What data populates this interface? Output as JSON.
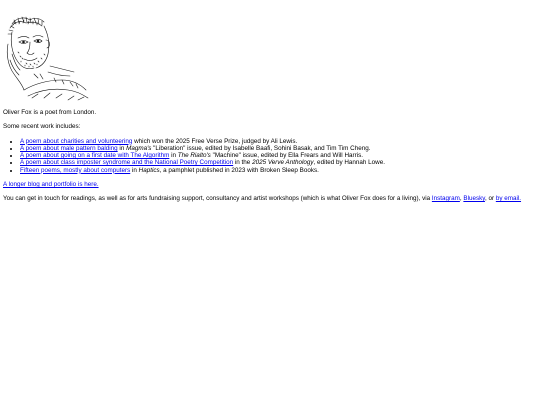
{
  "portrait": {
    "icon": "self-portrait-sketch-icon"
  },
  "intro": "Oliver Fox is a poet from London.",
  "recent_heading": "Some recent work includes:",
  "works": [
    {
      "link": "A poem about charities and volunteering",
      "pre_italic": " which won the 2025 Free Verse Prize, judged by Ali Lewis.",
      "italic": "",
      "post": ""
    },
    {
      "link": "A poem about male pattern balding",
      "pre_italic": " in ",
      "italic": "Magma's",
      "post": " \"Liberation\" issue, edited by Isabelle Baafi, Sohini Basak, and Tim Tim Cheng."
    },
    {
      "link": "A poem about going on a first date with The Algorithm",
      "pre_italic": " in ",
      "italic": "The Rialto's",
      "post": " \"Machine\" issue, edited by Ella Frears and Will Harris."
    },
    {
      "link": "A poem about class imposter syndrome and the National Poetry Competition",
      "pre_italic": " in the ",
      "italic": "2025 Verve Anthology",
      "post": ", edited by Hannah Lowe."
    },
    {
      "link": "Fifteen poems, mostly about computers",
      "pre_italic": " in ",
      "italic": "Haptics",
      "post": ", a pamphlet published in 2023 with Broken Sleep Books."
    }
  ],
  "blog_link": "A longer blog and portfolio is here.",
  "contact": {
    "text": "You can get in touch for readings, as well as for arts fundraising support, consultancy and artist workshops (which is what Oliver Fox does for a living), via ",
    "instagram": "Instagram",
    "sep1": ", ",
    "bluesky": "Bluesky",
    "sep2": ", or ",
    "email": "by email."
  },
  "colors": {
    "link": "#0000ee",
    "text": "#000000",
    "background": "#ffffff"
  }
}
